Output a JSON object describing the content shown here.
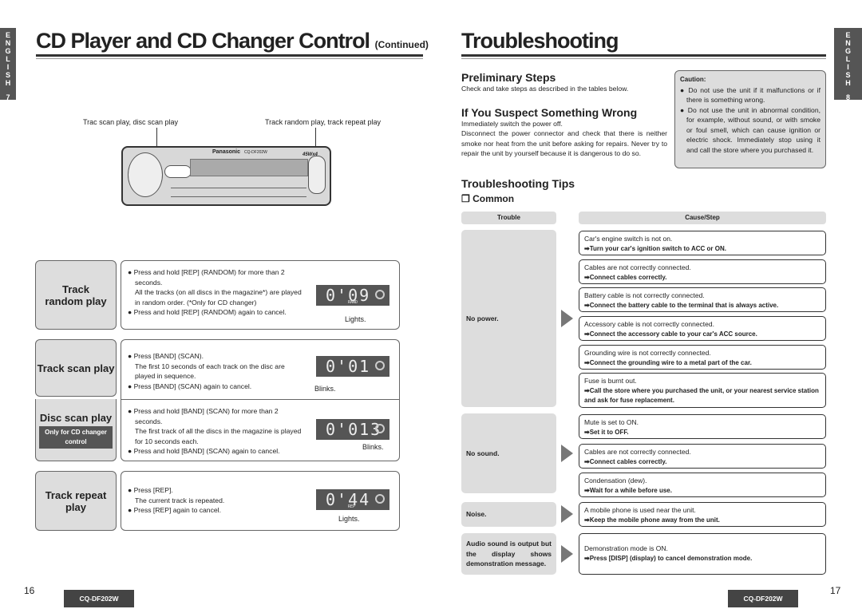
{
  "left_page": {
    "tab_letters": [
      "E",
      "N",
      "G",
      "L",
      "I",
      "S",
      "H"
    ],
    "tab_number": "7",
    "title": "CD Player and CD Changer Control",
    "title_suffix": "(Continued)",
    "label_left": "Trac scan play, disc scan play",
    "label_right": "Track random play, track repeat play",
    "device": {
      "brand": "Panasonic",
      "model": "CQ-DF202W",
      "power": "45Wx4"
    },
    "modes": [
      {
        "title": "Track random play",
        "bullets": [
          "Press and hold [REP] (RANDOM) for more than 2 seconds.",
          "All the tracks (on all discs in the magazine*) are played in random order. (*Only for CD changer)",
          "Press and hold [REP] (RANDOM) again to cancel."
        ],
        "display": "0'09",
        "indicator": "RAND",
        "caption": "Lights."
      },
      {
        "title": "Track scan play",
        "bullets": [
          "Press [BAND] (SCAN).",
          "The first 10 seconds of each track on the disc are played in sequence.",
          "Press [BAND] (SCAN) again to cancel."
        ],
        "display": "0'01",
        "caption": "Blinks."
      },
      {
        "title": "Disc scan play",
        "note": "Only for CD changer control",
        "bullets": [
          "Press and hold [BAND] (SCAN) for more than 2 seconds.",
          "The first track of all the discs in the magazine is played for 10 seconds each.",
          "Press and hold [BAND] (SCAN) again to cancel."
        ],
        "display": "0'013",
        "caption": "Blinks."
      },
      {
        "title": "Track repeat play",
        "bullets": [
          "Press [REP].",
          "The current track is repeated.",
          "Press [REP] again to cancel."
        ],
        "display": "0'44",
        "indicator": "REP",
        "caption": "Lights."
      }
    ],
    "page_number": "16",
    "model": "CQ-DF202W"
  },
  "right_page": {
    "tab_letters": [
      "E",
      "N",
      "G",
      "L",
      "I",
      "S",
      "H"
    ],
    "tab_number": "8",
    "title": "Troubleshooting",
    "prelim_heading": "Preliminary Steps",
    "prelim_text": "Check and take steps as described in the tables below.",
    "suspect_heading": "If You Suspect Something Wrong",
    "suspect_text1": "Immediately switch the power off.",
    "suspect_text2": "Disconnect the power connector and check that there is neither smoke nor heat from the unit before asking for repairs. Never try to repair the unit by yourself because it is dangerous to do so.",
    "caution_title": "Caution:",
    "caution_items": [
      "Do not use the unit if it malfunctions or if there is something wrong.",
      "Do not use the unit in abnormal condition, for example, without sound, or with smoke or foul smell, which can cause ignition or electric shock. Immediately stop using it and call the store where you purchased it."
    ],
    "tips_heading": "Troubleshooting Tips",
    "common_heading": "❒ Common",
    "col_trouble": "Trouble",
    "col_cause": "Cause/Step",
    "troubles": [
      "No power.",
      "No sound.",
      "Noise.",
      "Audio sound is output but the display shows demonstration message."
    ],
    "causes": [
      {
        "cause": "Car's engine switch is not on.",
        "step": "➡Turn your car's ignition switch to ACC or ON."
      },
      {
        "cause": "Cables are not correctly connected.",
        "step": "➡Connect cables correctly."
      },
      {
        "cause": "Battery cable is not correctly connected.",
        "step": "➡Connect the battery cable to the terminal that is always active."
      },
      {
        "cause": "Accessory cable is not correctly connected.",
        "step": "➡Connect the accessory cable to your car's ACC source."
      },
      {
        "cause": "Grounding wire is not correctly connected.",
        "step": "➡Connect the grounding wire to a metal part of the car."
      },
      {
        "cause": "Fuse is burnt out.",
        "step": "➡Call the store where you purchased the unit, or your nearest service station and ask for fuse replacement."
      },
      {
        "cause": "Mute is set to ON.",
        "step": "➡Set it to OFF."
      },
      {
        "cause": "Cables are not correctly connected.",
        "step": "➡Connect cables correctly."
      },
      {
        "cause": "Condensation (dew).",
        "step": "➡Wait for a while before use."
      },
      {
        "cause": "A mobile phone is used near the unit.",
        "step": "➡Keep the mobile phone away from the unit."
      },
      {
        "cause": "Demonstration mode is ON.",
        "step": "➡Press [DISP] (display) to cancel demonstration mode."
      }
    ],
    "page_number": "17",
    "model": "CQ-DF202W"
  }
}
